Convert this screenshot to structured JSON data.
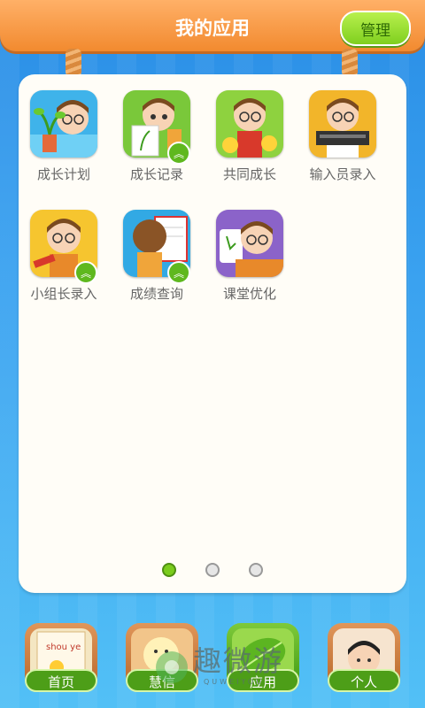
{
  "header": {
    "title": "我的应用",
    "manage_label": "管理"
  },
  "apps": [
    {
      "label": "成长计划",
      "icon": "growth-plan-icon"
    },
    {
      "label": "成长记录",
      "icon": "growth-record-icon"
    },
    {
      "label": "共同成长",
      "icon": "grow-together-icon"
    },
    {
      "label": "输入员录入",
      "icon": "input-clerk-icon"
    },
    {
      "label": "小组长录入",
      "icon": "group-leader-icon"
    },
    {
      "label": "成绩查询",
      "icon": "score-query-icon"
    },
    {
      "label": "课堂优化",
      "icon": "class-optimize-icon"
    }
  ],
  "pagination": {
    "pages": 3,
    "current": 1
  },
  "bottom_nav": [
    {
      "label": "首页",
      "icon": "home-book-icon"
    },
    {
      "label": "慧信",
      "icon": "message-chick-icon"
    },
    {
      "label": "应用",
      "icon": "leaf-icon"
    },
    {
      "label": "个人",
      "icon": "profile-avatar-icon"
    }
  ],
  "home_icon_text": "shou ye",
  "watermark": {
    "text": "趣微游",
    "sub": "QUWEIYOU"
  }
}
